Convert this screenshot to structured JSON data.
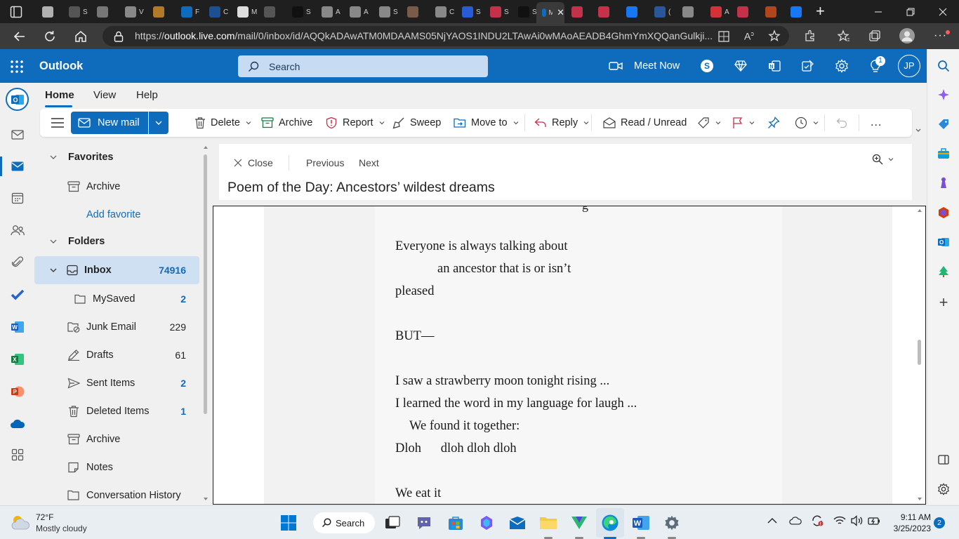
{
  "browser": {
    "tab_texts": [
      "",
      "S",
      "",
      "V",
      "",
      "F",
      "C",
      "M",
      "",
      "S",
      "A",
      "A",
      "S",
      "",
      "C",
      "S",
      "S",
      "S",
      "",
      "",
      "",
      "(",
      "",
      "A",
      "",
      "",
      "",
      "("
    ],
    "active_tab_text": "M",
    "url_prefix": "https://",
    "url_host": "outlook.live.com",
    "url_path": "/mail/0/inbox/id/AQQkADAwATM0MDAAMS05NjYAOS1INDU2LTAwAi0wMAoAEADB4GhmYmXQQanGulkji..."
  },
  "outlook": {
    "brand": "Outlook",
    "search_placeholder": "Search",
    "meet_now": "Meet Now",
    "notification_count": "1",
    "user_initials": "JP"
  },
  "ribbon": {
    "tabs": [
      "Home",
      "View",
      "Help"
    ],
    "new_mail": "New mail",
    "delete": "Delete",
    "archive": "Archive",
    "report": "Report",
    "sweep": "Sweep",
    "move_to": "Move to",
    "reply": "Reply",
    "read_unread": "Read / Unread",
    "more": "..."
  },
  "folders": {
    "favorites_header": "Favorites",
    "favorites": [
      {
        "label": "Archive"
      }
    ],
    "add_favorite": "Add favorite",
    "folders_header": "Folders",
    "items": [
      {
        "label": "Inbox",
        "count": "74916"
      },
      {
        "label": "MySaved",
        "count": "2"
      },
      {
        "label": "Junk Email",
        "count": "229"
      },
      {
        "label": "Drafts",
        "count": "61"
      },
      {
        "label": "Sent Items",
        "count": "2"
      },
      {
        "label": "Deleted Items",
        "count": "1"
      },
      {
        "label": "Archive",
        "count": ""
      },
      {
        "label": "Notes",
        "count": ""
      },
      {
        "label": "Conversation History",
        "count": ""
      }
    ]
  },
  "reader": {
    "close": "Close",
    "previous": "Previous",
    "next": "Next",
    "subject": "Poem of the Day: Ancestors’ wildest dreams"
  },
  "poem": {
    "lines": [
      "Everyone is always talking about",
      "an ancestor that is or isn’t",
      "pleased",
      "BUT—",
      "I saw a strawberry moon tonight rising ...",
      "I learned the word in my language for laugh ...",
      "We found it together:",
      "Dloh      dloh dloh dloh",
      "We eat it"
    ]
  },
  "taskbar": {
    "weather_temp": "72°F",
    "weather_desc": "Mostly cloudy",
    "search_label": "Search",
    "time": "9:11 AM",
    "date": "3/25/2023",
    "notification_count": "2"
  },
  "colors": {
    "outlook_blue": "#0f6cbd",
    "selected_folder": "#cfe0f3",
    "browser_dark": "#1f1f1f"
  }
}
